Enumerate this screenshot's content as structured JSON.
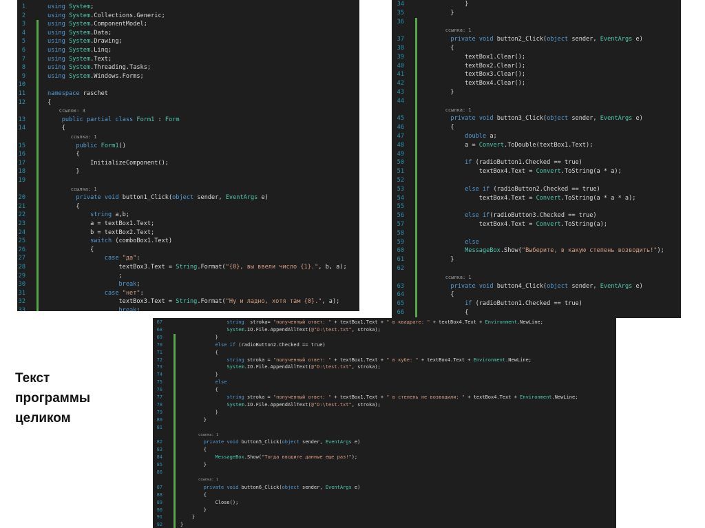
{
  "caption": {
    "lines": [
      "Текст",
      "программы",
      "целиком"
    ]
  },
  "panels": [
    {
      "name": "code-panel-top-left",
      "lines": [
        {
          "n": "1",
          "t": "using System;"
        },
        {
          "n": "2",
          "t": "using System.Collections.Generic;"
        },
        {
          "n": "3",
          "t": "using System.ComponentModel;"
        },
        {
          "n": "4",
          "t": "using System.Data;"
        },
        {
          "n": "5",
          "t": "using System.Drawing;"
        },
        {
          "n": "6",
          "t": "using System.Linq;"
        },
        {
          "n": "7",
          "t": "using System.Text;"
        },
        {
          "n": "8",
          "t": "using System.Threading.Tasks;"
        },
        {
          "n": "9",
          "t": "using System.Windows.Forms;"
        },
        {
          "n": "10",
          "t": ""
        },
        {
          "n": "11",
          "t": "namespace raschet"
        },
        {
          "n": "12",
          "t": "{"
        },
        {
          "n": "",
          "t": "    Ссылок: 3"
        },
        {
          "n": "13",
          "t": "    public partial class Form1 : Form"
        },
        {
          "n": "14",
          "t": "    {"
        },
        {
          "n": "",
          "t": "        ссылка: 1"
        },
        {
          "n": "15",
          "t": "        public Form1()"
        },
        {
          "n": "16",
          "t": "        {"
        },
        {
          "n": "17",
          "t": "            InitializeComponent();"
        },
        {
          "n": "18",
          "t": "        }"
        },
        {
          "n": "19",
          "t": ""
        },
        {
          "n": "",
          "t": "        ссылка: 1"
        },
        {
          "n": "20",
          "t": "        private void button1_Click(object sender, EventArgs e)"
        },
        {
          "n": "21",
          "t": "        {"
        },
        {
          "n": "22",
          "t": "            string a,b;"
        },
        {
          "n": "23",
          "t": "            a = textBox1.Text;"
        },
        {
          "n": "24",
          "t": "            b = textBox2.Text;"
        },
        {
          "n": "25",
          "t": "            switch (comboBox1.Text)"
        },
        {
          "n": "26",
          "t": "            {"
        },
        {
          "n": "27",
          "t": "                case \"да\":"
        },
        {
          "n": "28",
          "t": "                    textBox3.Text = String.Format(\"{0}, вы ввели число {1}.\", b, a);"
        },
        {
          "n": "29",
          "t": "                    ;"
        },
        {
          "n": "30",
          "t": "                    break;"
        },
        {
          "n": "31",
          "t": "                case \"нет\":"
        },
        {
          "n": "32",
          "t": "                    textBox3.Text = String.Format(\"Ну и ладно, хотя там {0}.\", a);"
        },
        {
          "n": "33",
          "t": "                    break;"
        }
      ]
    },
    {
      "name": "code-panel-top-right",
      "lines": [
        {
          "n": "34",
          "t": "            }"
        },
        {
          "n": "35",
          "t": "        }"
        },
        {
          "n": "36",
          "t": ""
        },
        {
          "n": "",
          "t": "        ссылка: 1"
        },
        {
          "n": "37",
          "t": "        private void button2_Click(object sender, EventArgs e)"
        },
        {
          "n": "38",
          "t": "        {"
        },
        {
          "n": "39",
          "t": "            textBox1.Clear();"
        },
        {
          "n": "40",
          "t": "            textBox2.Clear();"
        },
        {
          "n": "41",
          "t": "            textBox3.Clear();"
        },
        {
          "n": "42",
          "t": "            textBox4.Clear();"
        },
        {
          "n": "43",
          "t": "        }"
        },
        {
          "n": "44",
          "t": ""
        },
        {
          "n": "",
          "t": "        ссылка: 1"
        },
        {
          "n": "45",
          "t": "        private void button3_Click(object sender, EventArgs e)"
        },
        {
          "n": "46",
          "t": "        {"
        },
        {
          "n": "47",
          "t": "            double a;"
        },
        {
          "n": "48",
          "t": "            a = Convert.ToDouble(textBox1.Text);"
        },
        {
          "n": "49",
          "t": ""
        },
        {
          "n": "50",
          "t": "            if (radioButton1.Checked == true)"
        },
        {
          "n": "51",
          "t": "                textBox4.Text = Convert.ToString(a * a);"
        },
        {
          "n": "52",
          "t": ""
        },
        {
          "n": "53",
          "t": "            else if (radioButton2.Checked == true)"
        },
        {
          "n": "54",
          "t": "                textBox4.Text = Convert.ToString(a * a * a);"
        },
        {
          "n": "55",
          "t": ""
        },
        {
          "n": "56",
          "t": "            else if(radioButton3.Checked == true)"
        },
        {
          "n": "57",
          "t": "                textBox4.Text = Convert.ToString(a);"
        },
        {
          "n": "58",
          "t": ""
        },
        {
          "n": "59",
          "t": "            else"
        },
        {
          "n": "60",
          "t": "            MessageBox.Show(\"Выберите, в какую степень возводить!\");"
        },
        {
          "n": "61",
          "t": "        }"
        },
        {
          "n": "62",
          "t": ""
        },
        {
          "n": "",
          "t": "        ссылка: 1"
        },
        {
          "n": "63",
          "t": "        private void button4_Click(object sender, EventArgs e)"
        },
        {
          "n": "64",
          "t": "        {"
        },
        {
          "n": "65",
          "t": "            if (radioButton1.Checked == true)"
        },
        {
          "n": "66",
          "t": "            {"
        }
      ]
    },
    {
      "name": "code-panel-bottom",
      "lines": [
        {
          "n": "67",
          "t": "                string  stroka= \"полученный ответ: \" + textBox1.Text + \" в квадрате: \" + textBox4.Text + Environment.NewLine;"
        },
        {
          "n": "68",
          "t": "                System.IO.File.AppendAllText(@\"D:\\test.txt\", stroka);"
        },
        {
          "n": "69",
          "t": "            }"
        },
        {
          "n": "70",
          "t": "            else if (radioButton2.Checked == true)"
        },
        {
          "n": "71",
          "t": "            {"
        },
        {
          "n": "72",
          "t": "                string stroka = \"полученный ответ: \" + textBox1.Text + \" в кубе: \" + textBox4.Text + Environment.NewLine;"
        },
        {
          "n": "73",
          "t": "                System.IO.File.AppendAllText(@\"D:\\test.txt\", stroka);"
        },
        {
          "n": "74",
          "t": "            }"
        },
        {
          "n": "75",
          "t": "            else"
        },
        {
          "n": "76",
          "t": "            {"
        },
        {
          "n": "77",
          "t": "                string stroka = \"полученный ответ: \" + textBox1.Text + \" в степень не возводили: \" + textBox4.Text + Environment.NewLine;"
        },
        {
          "n": "78",
          "t": "                System.IO.File.AppendAllText(@\"D:\\test.txt\", stroka);"
        },
        {
          "n": "79",
          "t": "            }"
        },
        {
          "n": "80",
          "t": "        }"
        },
        {
          "n": "81",
          "t": ""
        },
        {
          "n": "",
          "t": "        ссылка: 1"
        },
        {
          "n": "82",
          "t": "        private void button5_Click(object sender, EventArgs e)"
        },
        {
          "n": "83",
          "t": "        {"
        },
        {
          "n": "84",
          "t": "            MessageBox.Show(\"Тогда вводите данные еще раз!\");"
        },
        {
          "n": "85",
          "t": "        }"
        },
        {
          "n": "86",
          "t": ""
        },
        {
          "n": "",
          "t": "        ссылка: 1"
        },
        {
          "n": "87",
          "t": "        private void button6_Click(object sender, EventArgs e)"
        },
        {
          "n": "88",
          "t": "        {"
        },
        {
          "n": "89",
          "t": "            Close();"
        },
        {
          "n": "90",
          "t": "        }"
        },
        {
          "n": "91",
          "t": "    }"
        },
        {
          "n": "92",
          "t": "}"
        }
      ]
    }
  ],
  "colors": {
    "editor_bg": "#1e1e1e",
    "line_number": "#2b91af",
    "keyword": "#569cd6",
    "type": "#4ec9b0",
    "string": "#d69d85",
    "text": "#dcdcdc",
    "change_bar": "#57a64a"
  }
}
